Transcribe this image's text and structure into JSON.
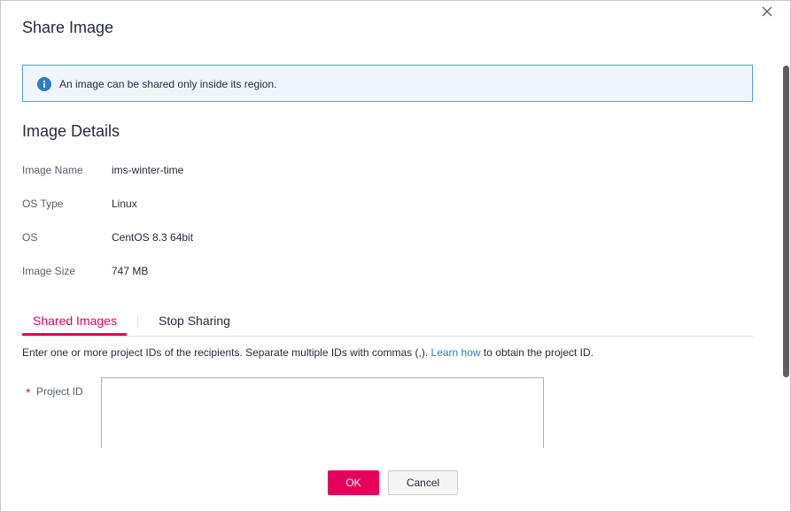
{
  "dialog": {
    "title": "Share Image",
    "close_icon": "close-icon"
  },
  "notice": {
    "icon": "info-icon",
    "text": "An image can be shared only inside its region.",
    "accent_color": "#2e7cc6"
  },
  "details": {
    "section_title": "Image Details",
    "rows": [
      {
        "label": "Image Name",
        "value": "ims-winter-time"
      },
      {
        "label": "OS Type",
        "value": "Linux"
      },
      {
        "label": "OS",
        "value": "CentOS 8.3 64bit"
      },
      {
        "label": "Image Size",
        "value": "747 MB"
      }
    ]
  },
  "tabs": {
    "items": [
      {
        "label": "Shared Images",
        "active": true
      },
      {
        "label": "Stop Sharing",
        "active": false
      }
    ],
    "active_color": "#e6005c"
  },
  "hint": {
    "before": "Enter one or more project IDs of the recipients. Separate multiple IDs with commas (,).",
    "link": "Learn how",
    "after": "to obtain the project ID."
  },
  "form": {
    "required_mark": "*",
    "project_id_label": "Project ID",
    "project_id_value": ""
  },
  "footer": {
    "ok_label": "OK",
    "cancel_label": "Cancel"
  }
}
